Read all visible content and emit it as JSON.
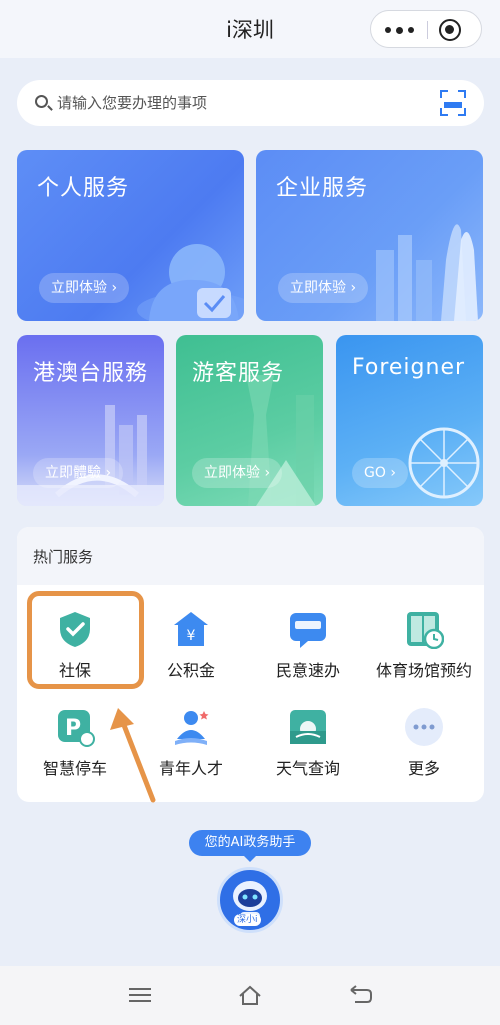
{
  "app": {
    "title": "i深圳"
  },
  "capsule": {
    "more_icon": "more-dots-icon",
    "close_icon": "target-close-icon"
  },
  "search": {
    "placeholder": "请输入您要办理的事项",
    "scan_icon": "scan-icon"
  },
  "cards": {
    "personal": {
      "name": "个人服务",
      "action": "立即体验 ›"
    },
    "business": {
      "name": "企业服务",
      "action": "立即体验 ›"
    },
    "hmt": {
      "name": "港澳台服務",
      "action": "立即體驗 ›"
    },
    "tourist": {
      "name": "游客服务",
      "action": "立即体验 ›"
    },
    "foreigner": {
      "name": "Foreigner",
      "action": "GO ›"
    }
  },
  "hot_services": {
    "title": "热门服务",
    "items": [
      {
        "label": "社保",
        "icon": "shield-check-icon"
      },
      {
        "label": "公积金",
        "icon": "housing-fund-icon"
      },
      {
        "label": "民意速办",
        "icon": "i-shenzhen-chat-icon"
      },
      {
        "label": "体育场馆预约",
        "icon": "stadium-clock-icon"
      },
      {
        "label": "智慧停车",
        "icon": "parking-icon"
      },
      {
        "label": "青年人才",
        "icon": "youth-talent-icon"
      },
      {
        "label": "天气查询",
        "icon": "weather-icon"
      },
      {
        "label": "更多",
        "icon": "more-icon"
      }
    ]
  },
  "assistant": {
    "bubble": "您的AI政务助手",
    "badge": "深小i"
  },
  "colors": {
    "accent": "#2f7bf2",
    "highlight": "#e69448",
    "background": "#e9eef8"
  }
}
